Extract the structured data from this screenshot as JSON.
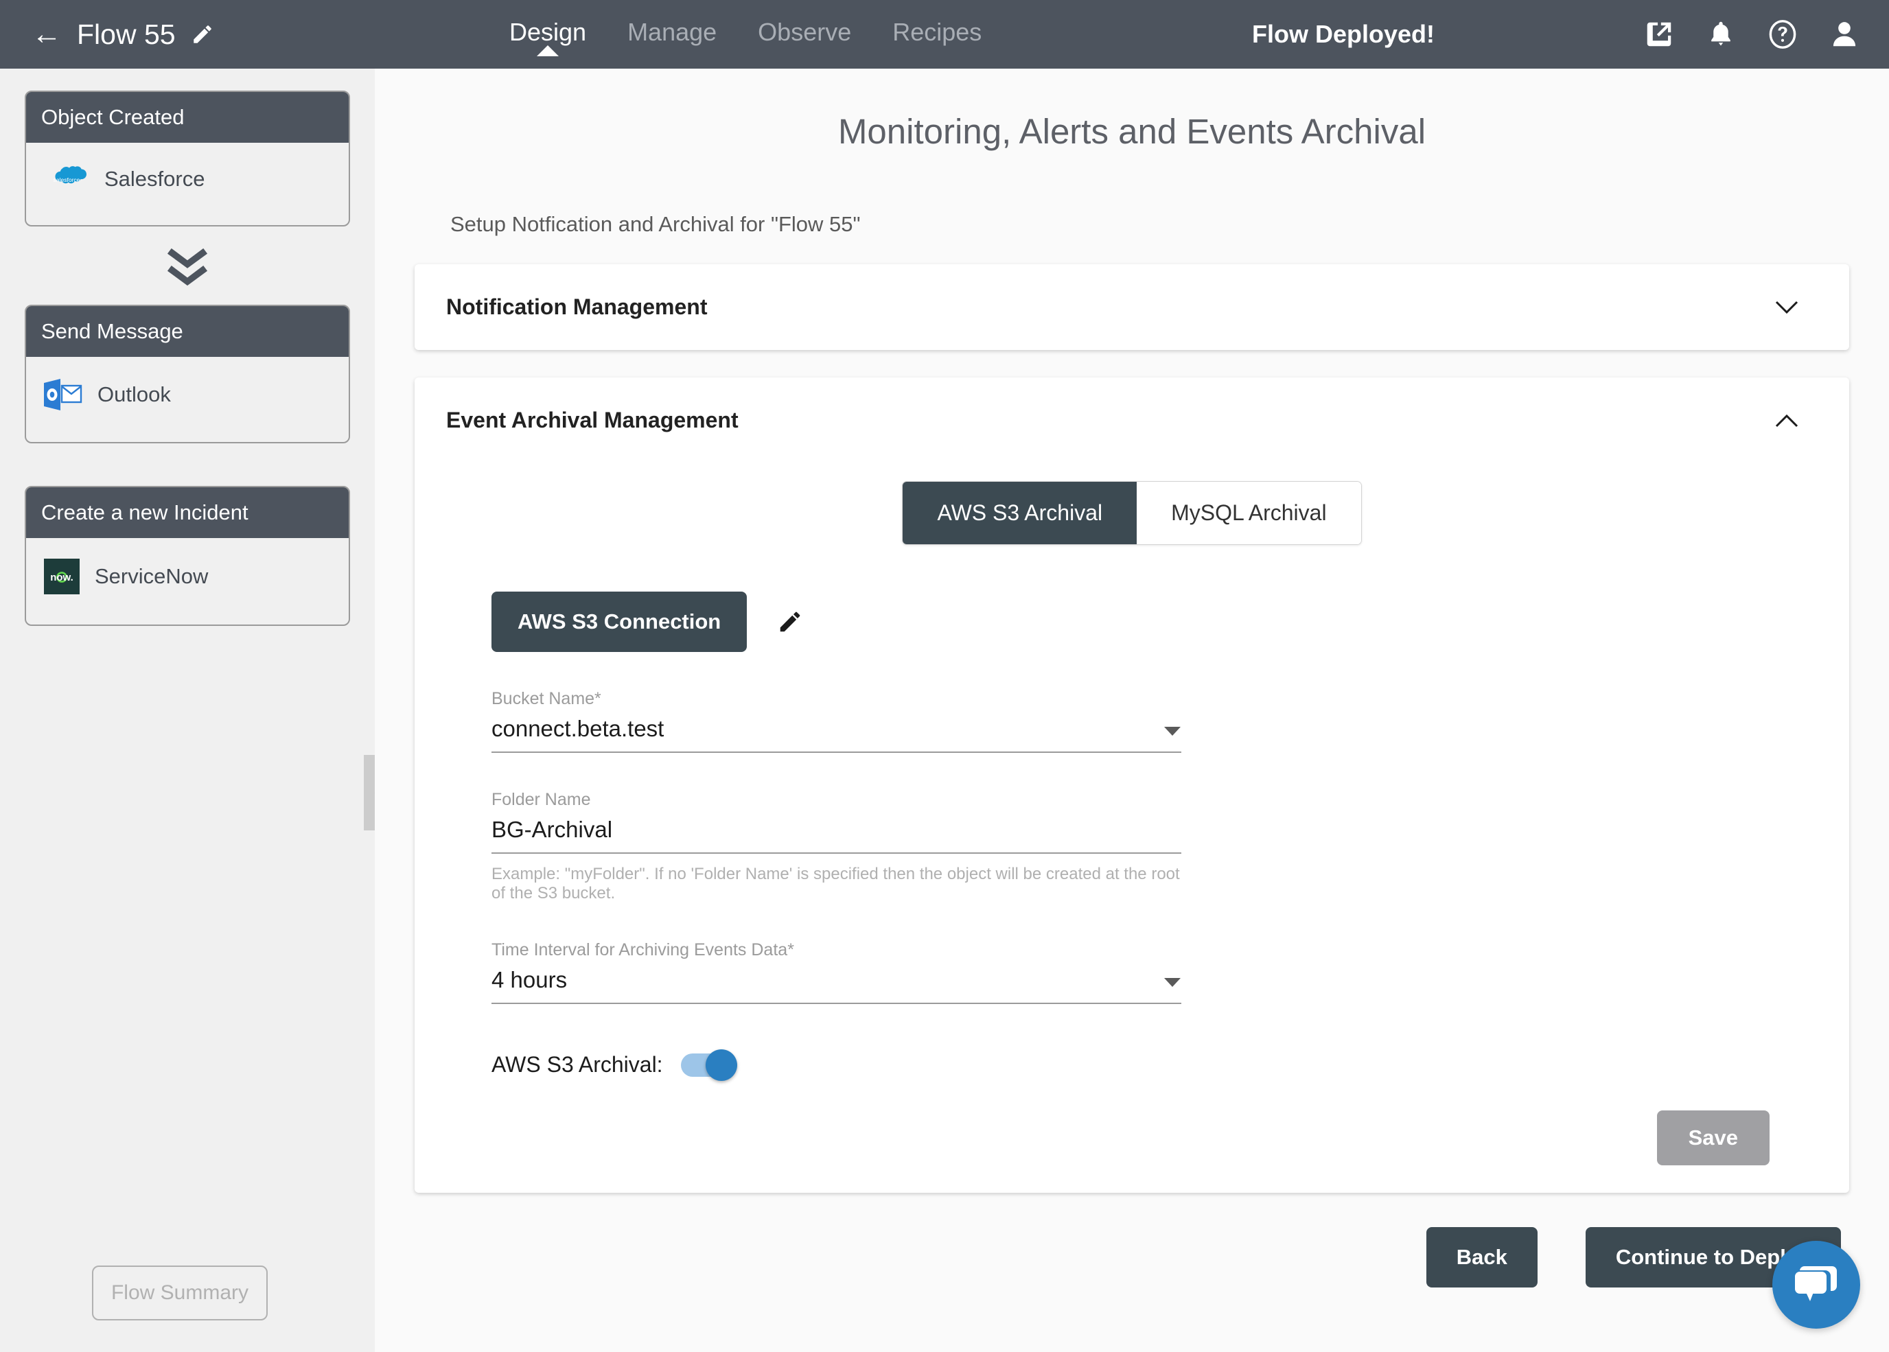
{
  "header": {
    "back_icon": "back-arrow-icon",
    "flow_title": "Flow 55",
    "edit_icon": "pencil-icon",
    "tabs": [
      {
        "label": "Design",
        "active": true
      },
      {
        "label": "Manage",
        "active": false
      },
      {
        "label": "Observe",
        "active": false
      },
      {
        "label": "Recipes",
        "active": false
      }
    ],
    "status_text": "Flow Deployed!",
    "icons": [
      "external-link-icon",
      "bell-icon",
      "help-icon",
      "user-avatar-icon"
    ]
  },
  "sidebar": {
    "nodes": [
      {
        "title": "Object Created",
        "app": "Salesforce",
        "logo": "salesforce-logo"
      },
      {
        "title": "Send Message",
        "app": "Outlook",
        "logo": "outlook-logo"
      },
      {
        "title": "Create a new Incident",
        "app": "ServiceNow",
        "logo": "servicenow-logo"
      }
    ],
    "connector_icon": "double-chevron-down-icon",
    "flow_summary_label": "Flow Summary",
    "collapse_icon": "chevron-left-icon"
  },
  "main": {
    "page_title": "Monitoring, Alerts and Events Archival",
    "subtitle": "Setup Notfication and Archival for \"Flow 55\"",
    "panels": [
      {
        "title": "Notification Management",
        "expanded": false,
        "chevron": "chevron-down-icon"
      },
      {
        "title": "Event Archival Management",
        "expanded": true,
        "chevron": "chevron-up-icon"
      }
    ],
    "archival": {
      "tabs": [
        {
          "label": "AWS S3 Archival",
          "selected": true
        },
        {
          "label": "MySQL Archival",
          "selected": false
        }
      ],
      "connection_button": "AWS S3 Connection",
      "connection_edit_icon": "pencil-icon",
      "fields": [
        {
          "label": "Bucket Name*",
          "value": "connect.beta.test",
          "type": "select",
          "hint": ""
        },
        {
          "label": "Folder Name",
          "value": "BG-Archival",
          "type": "text",
          "hint": "Example: \"myFolder\". If no 'Folder Name' is specified then the object will be created at the root of the S3 bucket."
        },
        {
          "label": "Time Interval for Archiving Events Data*",
          "value": "4 hours",
          "type": "select",
          "hint": ""
        }
      ],
      "toggle": {
        "label": "AWS S3 Archival:",
        "on": true
      },
      "save_label": "Save",
      "save_disabled": true
    },
    "actions": {
      "back_label": "Back",
      "continue_label": "Continue to Deploy"
    }
  },
  "chat_widget": {
    "icon": "chat-bubble-icon"
  },
  "colors": {
    "header_bg": "#4d545e",
    "accent_dark": "#3c4a52",
    "toggle_on": "#2a7fc1",
    "salesforce_blue": "#1798d4",
    "outlook_blue": "#2b7cd3",
    "servicenow_dark": "#1d3c3a",
    "servicenow_green": "#62d84e",
    "chat_blue": "#2a7fc1",
    "save_disabled": "#a0a0a3"
  }
}
